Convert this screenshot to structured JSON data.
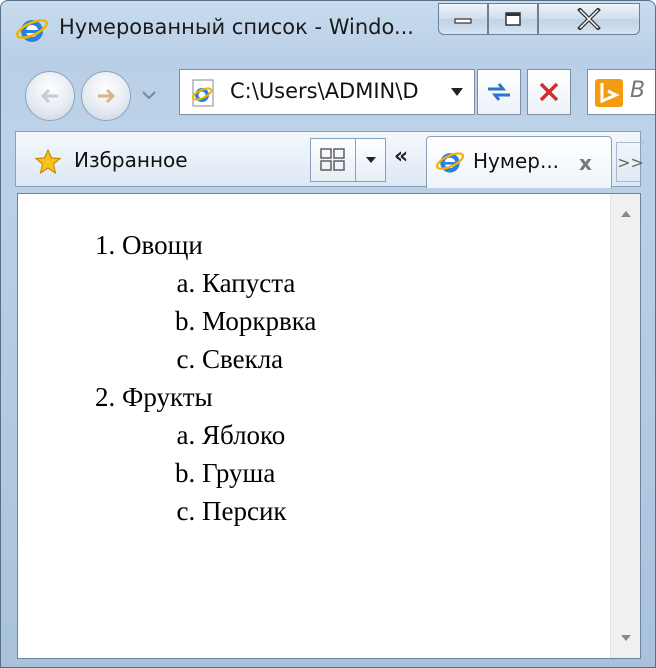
{
  "window": {
    "title": "Нумерованный список - Windo...",
    "controls": {
      "minimize_icon": "minimize-icon",
      "maximize_icon": "maximize-icon",
      "close_icon": "close-x-icon"
    }
  },
  "navigation": {
    "back_icon": "back-arrow-icon",
    "forward_icon": "forward-arrow-icon",
    "address": "C:\\Users\\ADMIN\\D",
    "refresh_icon": "compatibility-refresh-icon",
    "stop_icon": "stop-x-icon",
    "search_icon": "bing-icon",
    "search_placeholder": "B"
  },
  "favorites_bar": {
    "favorites_label": "Избранное",
    "active_tab_title": "Нумер...",
    "active_tab_close": "x",
    "more_tabs": ">>"
  },
  "document": {
    "list": [
      {
        "label": "Овощи",
        "items": [
          "Капуста",
          "Моркрвка",
          "Свекла"
        ]
      },
      {
        "label": "Фрукты",
        "items": [
          "Яблоко",
          "Груша",
          "Персик"
        ]
      }
    ]
  },
  "colors": {
    "window_frame": "#b8cfe6",
    "close_red": "#c7302b",
    "ie_blue": "#1f6fd1",
    "bing_orange": "#f39c12"
  }
}
